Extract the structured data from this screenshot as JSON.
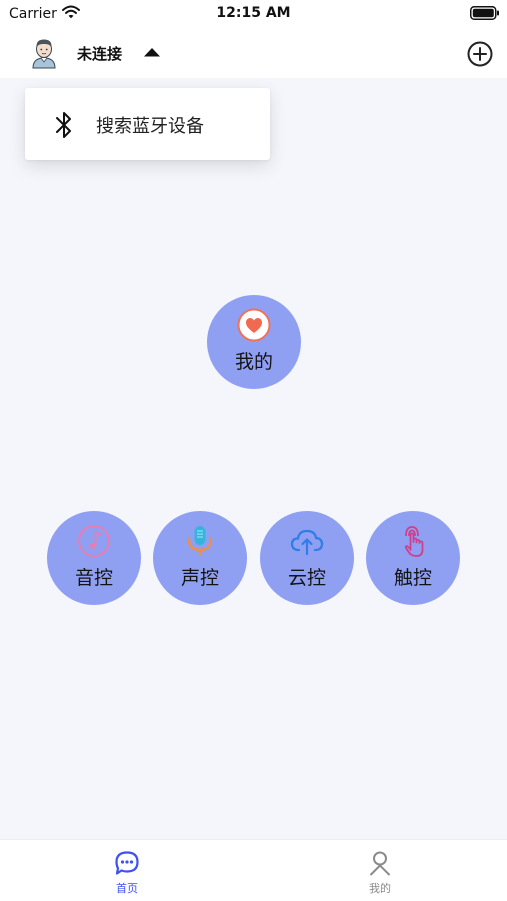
{
  "status_bar": {
    "carrier": "Carrier",
    "time": "12:15 AM"
  },
  "header": {
    "connection_status": "未连接",
    "avatar_icon": "user-avatar-icon",
    "caret_icon": "caret-up-icon",
    "add_icon": "plus-circle-icon"
  },
  "dropdown": {
    "items": [
      {
        "label": "搜索蓝牙设备",
        "icon": "bluetooth-icon"
      }
    ]
  },
  "main": {
    "mine_button": {
      "label": "我的",
      "icon": "heart-icon"
    },
    "controls": [
      {
        "label": "音控",
        "icon": "music-note-icon"
      },
      {
        "label": "声控",
        "icon": "microphone-icon"
      },
      {
        "label": "云控",
        "icon": "cloud-upload-icon"
      },
      {
        "label": "触控",
        "icon": "touch-finger-icon"
      }
    ]
  },
  "tab_bar": {
    "tabs": [
      {
        "label": "首页",
        "icon": "chat-bubble-icon",
        "active": true
      },
      {
        "label": "我的",
        "icon": "person-icon",
        "active": false
      }
    ]
  },
  "colors": {
    "circle_fill": "#8fa0f3",
    "tab_active": "#3f51f3",
    "tab_inactive": "#8a8a8a",
    "background": "#f5f6fb"
  }
}
